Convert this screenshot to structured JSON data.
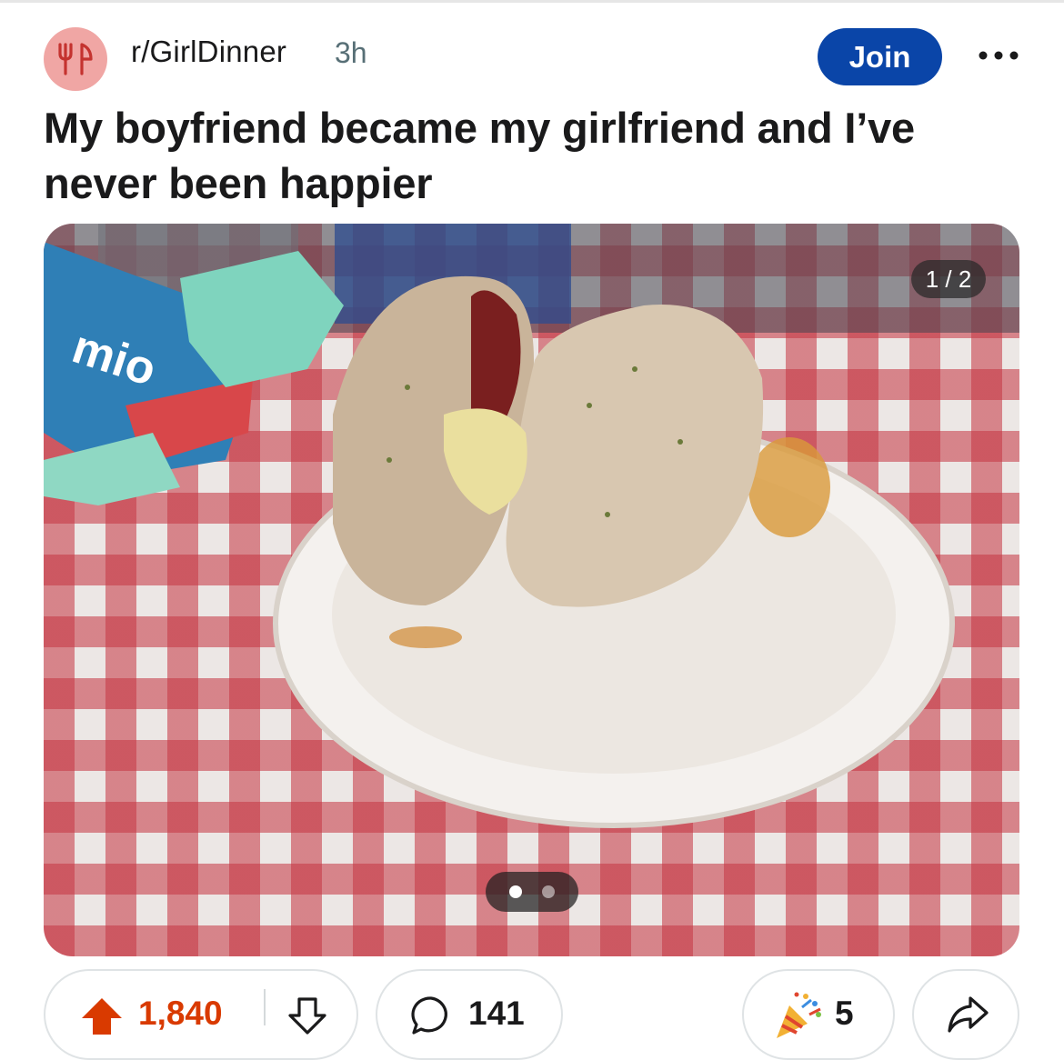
{
  "post": {
    "subreddit": "r/GirlDinner",
    "age": "3h",
    "join_label": "Join",
    "title": "My boyfriend became my girlfriend and I’ve never been happier"
  },
  "media": {
    "counter": "1 / 2",
    "image_count": 2,
    "current_index": 1,
    "package_text": "mio"
  },
  "actions": {
    "upvotes": "1,840",
    "comments": "141",
    "awards": "5"
  },
  "colors": {
    "join_bg": "#0a45a8",
    "upvote_active": "#d93a00",
    "avatar_bg": "#f0a6a4"
  },
  "icons": {
    "avatar": "fork-knife-icon",
    "more": "more-dots-icon",
    "upvote": "upvote-arrow-icon",
    "downvote": "downvote-arrow-icon",
    "comment": "comment-bubble-icon",
    "award": "party-popper-icon",
    "share": "share-arrow-icon"
  }
}
